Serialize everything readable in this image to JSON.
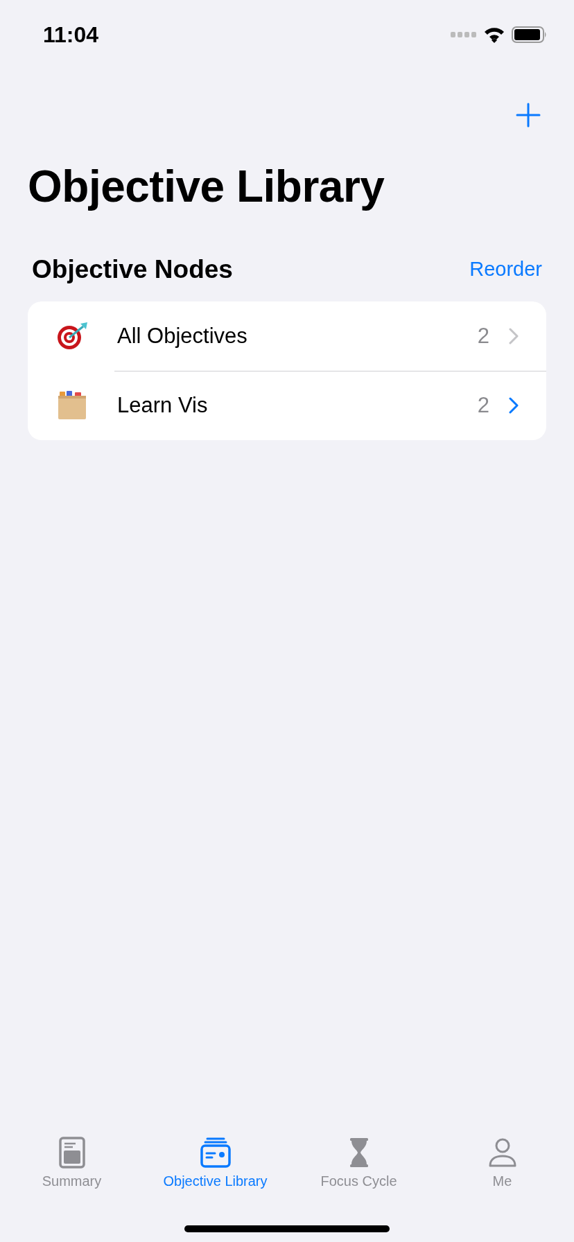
{
  "status_bar": {
    "time": "11:04"
  },
  "nav": {
    "title": "Objective Library"
  },
  "section": {
    "title": "Objective Nodes",
    "action": "Reorder"
  },
  "rows": [
    {
      "kind": "target",
      "label": "All Objectives",
      "count": "2",
      "highlighted": false
    },
    {
      "kind": "file-box",
      "label": "Learn Vis",
      "count": "2",
      "highlighted": true
    }
  ],
  "tabs": [
    {
      "kind": "summary",
      "label": "Summary",
      "selected": false
    },
    {
      "kind": "library",
      "label": "Objective Library",
      "selected": true
    },
    {
      "kind": "hourglass",
      "label": "Focus Cycle",
      "selected": false
    },
    {
      "kind": "person",
      "label": "Me",
      "selected": false
    }
  ]
}
